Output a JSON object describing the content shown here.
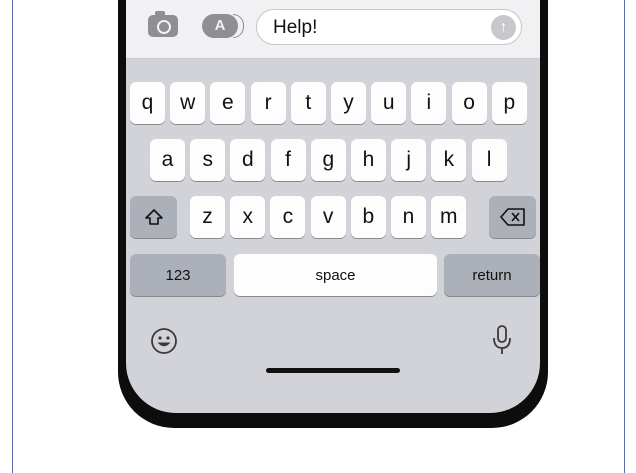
{
  "message_field": {
    "text": "Help!"
  },
  "icons": {
    "camera": "camera-icon",
    "apps": "app-store-icon",
    "apps_glyph": "A",
    "send": "send-arrow-icon",
    "send_glyph": "↑",
    "shift": "shift-icon",
    "delete": "backspace-icon",
    "emoji": "emoji-icon",
    "mic": "microphone-icon"
  },
  "keyboard": {
    "row1": [
      "q",
      "w",
      "e",
      "r",
      "t",
      "y",
      "u",
      "i",
      "o",
      "p"
    ],
    "row2": [
      "a",
      "s",
      "d",
      "f",
      "g",
      "h",
      "j",
      "k",
      "l"
    ],
    "row3": [
      "z",
      "x",
      "c",
      "v",
      "b",
      "n",
      "m"
    ],
    "numbers_label": "123",
    "space_label": "space",
    "return_label": "return"
  },
  "colors": {
    "keyboard_bg": "#d1d3d9",
    "key_bg": "#fdfdfd",
    "special_key_bg": "#acb0b8",
    "frame_border": "#5b6fb0"
  }
}
